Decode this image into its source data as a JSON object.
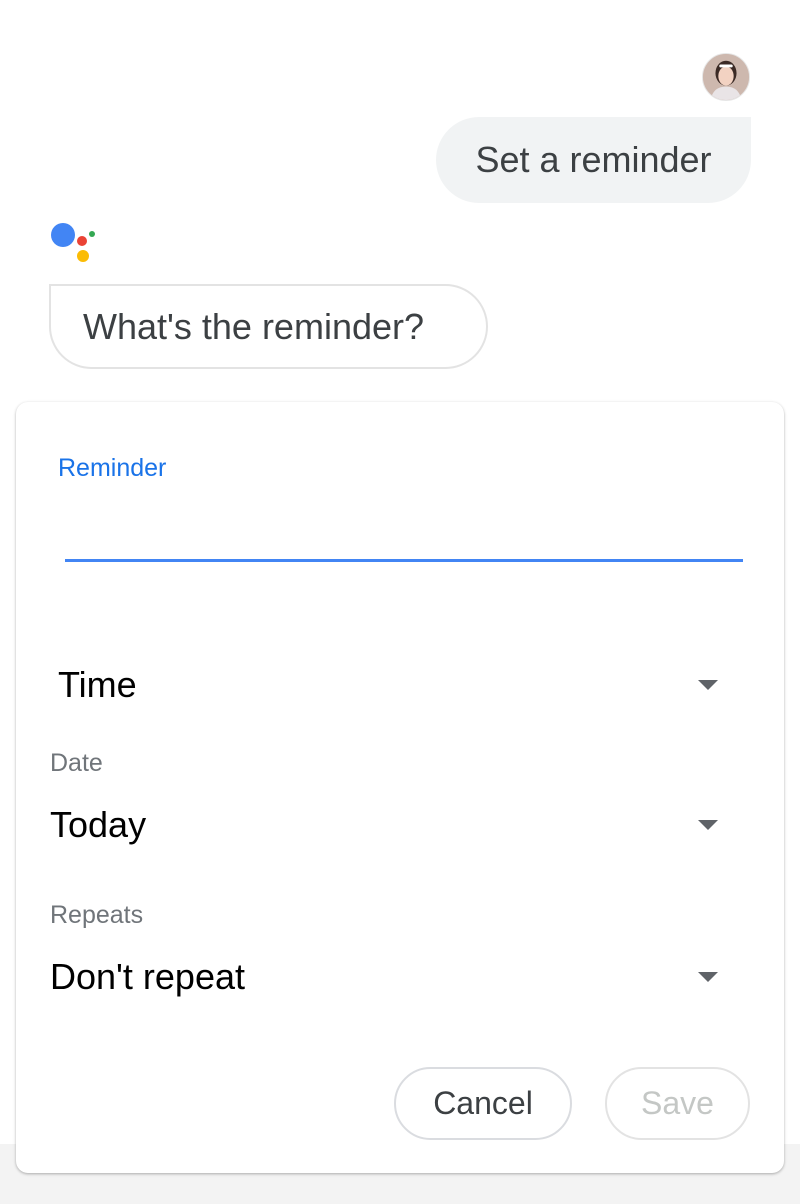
{
  "conversation": {
    "user_message": "Set a reminder",
    "assistant_message": "What's the reminder?"
  },
  "form": {
    "reminder_label": "Reminder",
    "reminder_value": "",
    "time_value": "Time",
    "date_label": "Date",
    "date_value": "Today",
    "repeats_label": "Repeats",
    "repeats_value": "Don't repeat"
  },
  "actions": {
    "cancel_label": "Cancel",
    "save_label": "Save"
  },
  "colors": {
    "accent_blue": "#1a73e8",
    "underline_blue": "#4285f4",
    "assistant_blue": "#4285f4",
    "assistant_red": "#ea4335",
    "assistant_yellow": "#fbbc05",
    "assistant_green": "#34a853"
  },
  "icons": {
    "avatar": "user-avatar",
    "assistant": "google-assistant-logo",
    "dropdown": "caret-down-icon"
  }
}
